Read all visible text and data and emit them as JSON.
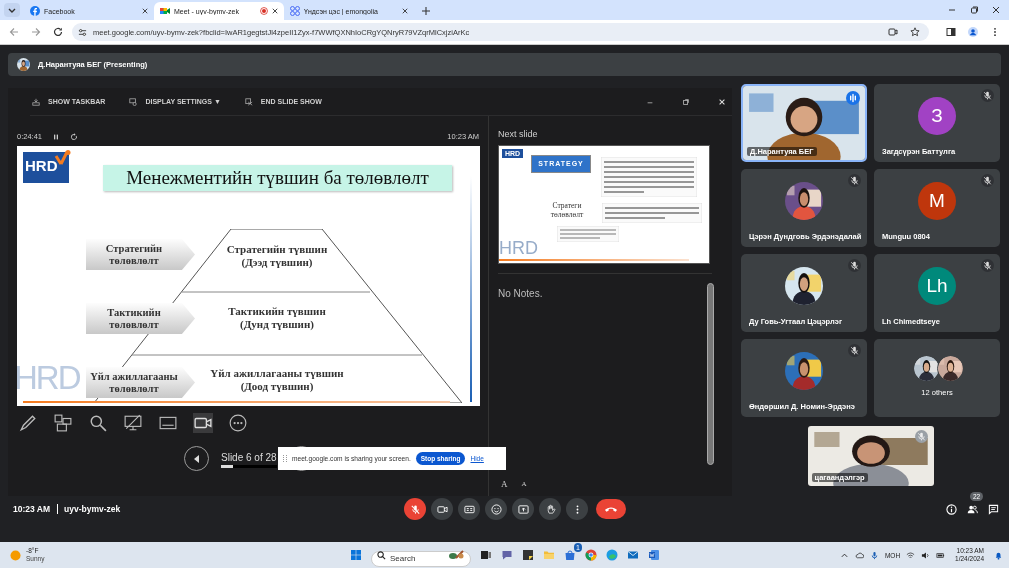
{
  "browser": {
    "tabs": [
      {
        "title": "Facebook",
        "kind": "facebook",
        "selected": false,
        "recording": false
      },
      {
        "title": "Meet - uyv-bymv-zek",
        "kind": "meet",
        "selected": true,
        "recording": true
      },
      {
        "title": "Үндсэн цэс | emongolia",
        "kind": "emongolia",
        "selected": false,
        "recording": false
      }
    ],
    "url": "meet.google.com/uyv-bymv-zek?fbclid=IwAR1gegtstJl4zpeII1Zyx-f7WWfQXNhIoCRgYQNryR79VZqrMlCxjziArKc"
  },
  "presenting": {
    "name": "Д.Нарантуяа БЕГ (Presenting)"
  },
  "presenter_view": {
    "toolbar": [
      {
        "kind": "taskbar",
        "label": "SHOW TASKBAR"
      },
      {
        "kind": "display",
        "label": "DISPLAY SETTINGS ▼"
      },
      {
        "kind": "end",
        "label": "END SLIDE SHOW"
      }
    ],
    "elapsed": "0:24:41",
    "clock": "10:23 AM",
    "slide": {
      "logo": "HRD",
      "title": "Менежментийн түвшин ба төлөвлөлт",
      "watermark": "HRD",
      "levels": [
        {
          "label": "Стратегийн төлөвлөлт",
          "name": "Стратегийн түвшин",
          "sub": "(Дээд түвшин)"
        },
        {
          "label": "Тактикийн төлөвлөлт",
          "name": "Тактикийн түвшин",
          "sub": "(Дунд түвшин)"
        },
        {
          "label": "Үйл ажиллагааны төлөвлөлт",
          "name": "Үйл ажиллагааны түвшин",
          "sub": "(Доод түвшин)"
        }
      ]
    },
    "next_slide": {
      "heading": "Next slide",
      "logo": "HRD",
      "banner": "STRATEGY",
      "caption": "Стратеги төлөвлөлт",
      "watermark": "HRD"
    },
    "notes": "No Notes.",
    "font_buttons": [
      {
        "kind": "increase",
        "label": "A"
      },
      {
        "kind": "decrease",
        "label": "A"
      }
    ],
    "slide_counter": "Slide 6 of 28",
    "progress": {
      "level": 0.21
    }
  },
  "share_notice": {
    "message": "meet.google.com is sharing your screen.",
    "stop": "Stop sharing",
    "hide": "Hide"
  },
  "participants": [
    {
      "name": "Д.Нарантуяа БЕГ",
      "kind": "video",
      "speaking": true,
      "muted": false
    },
    {
      "name": "Загдсүрэн Баттулга",
      "kind": "initial",
      "initial": "З",
      "color": "#a142c4",
      "speaking": false,
      "muted": true
    },
    {
      "name": "Цэрэн Дундговь Эрдэнэдалай",
      "speaking": false,
      "muted": true
    },
    {
      "name": "Munguu 0804",
      "kind": "initial",
      "initial": "M",
      "color": "#bf360c",
      "speaking": false,
      "muted": true
    },
    {
      "name": "Ду Говь-Угтаал Цэцэрлэг",
      "speaking": false,
      "muted": true
    },
    {
      "name": "Lh Chimedtseye",
      "kind": "initial",
      "initial": "Lh",
      "color": "#00897b",
      "speaking": false,
      "muted": true
    },
    {
      "name": "Өндөршил Д. Номин-Эрдэнэ",
      "speaking": false,
      "muted": true
    },
    {
      "name": "12 others",
      "kind": "others",
      "speaking": false,
      "muted": false
    }
  ],
  "self_view": {
    "name": "цагаандэлгэр",
    "muted": true
  },
  "call": {
    "time": "10:23 AM",
    "code": "uyv-bymv-zek",
    "mic_on": false,
    "people_count": "22"
  },
  "taskbar": {
    "temperature": "-8°F",
    "weather": "Sunny",
    "search": {
      "placeholder": "Search"
    },
    "store_badge": "1",
    "language": "МОН",
    "time": "10:23 AM",
    "date": "1/24/2024"
  }
}
